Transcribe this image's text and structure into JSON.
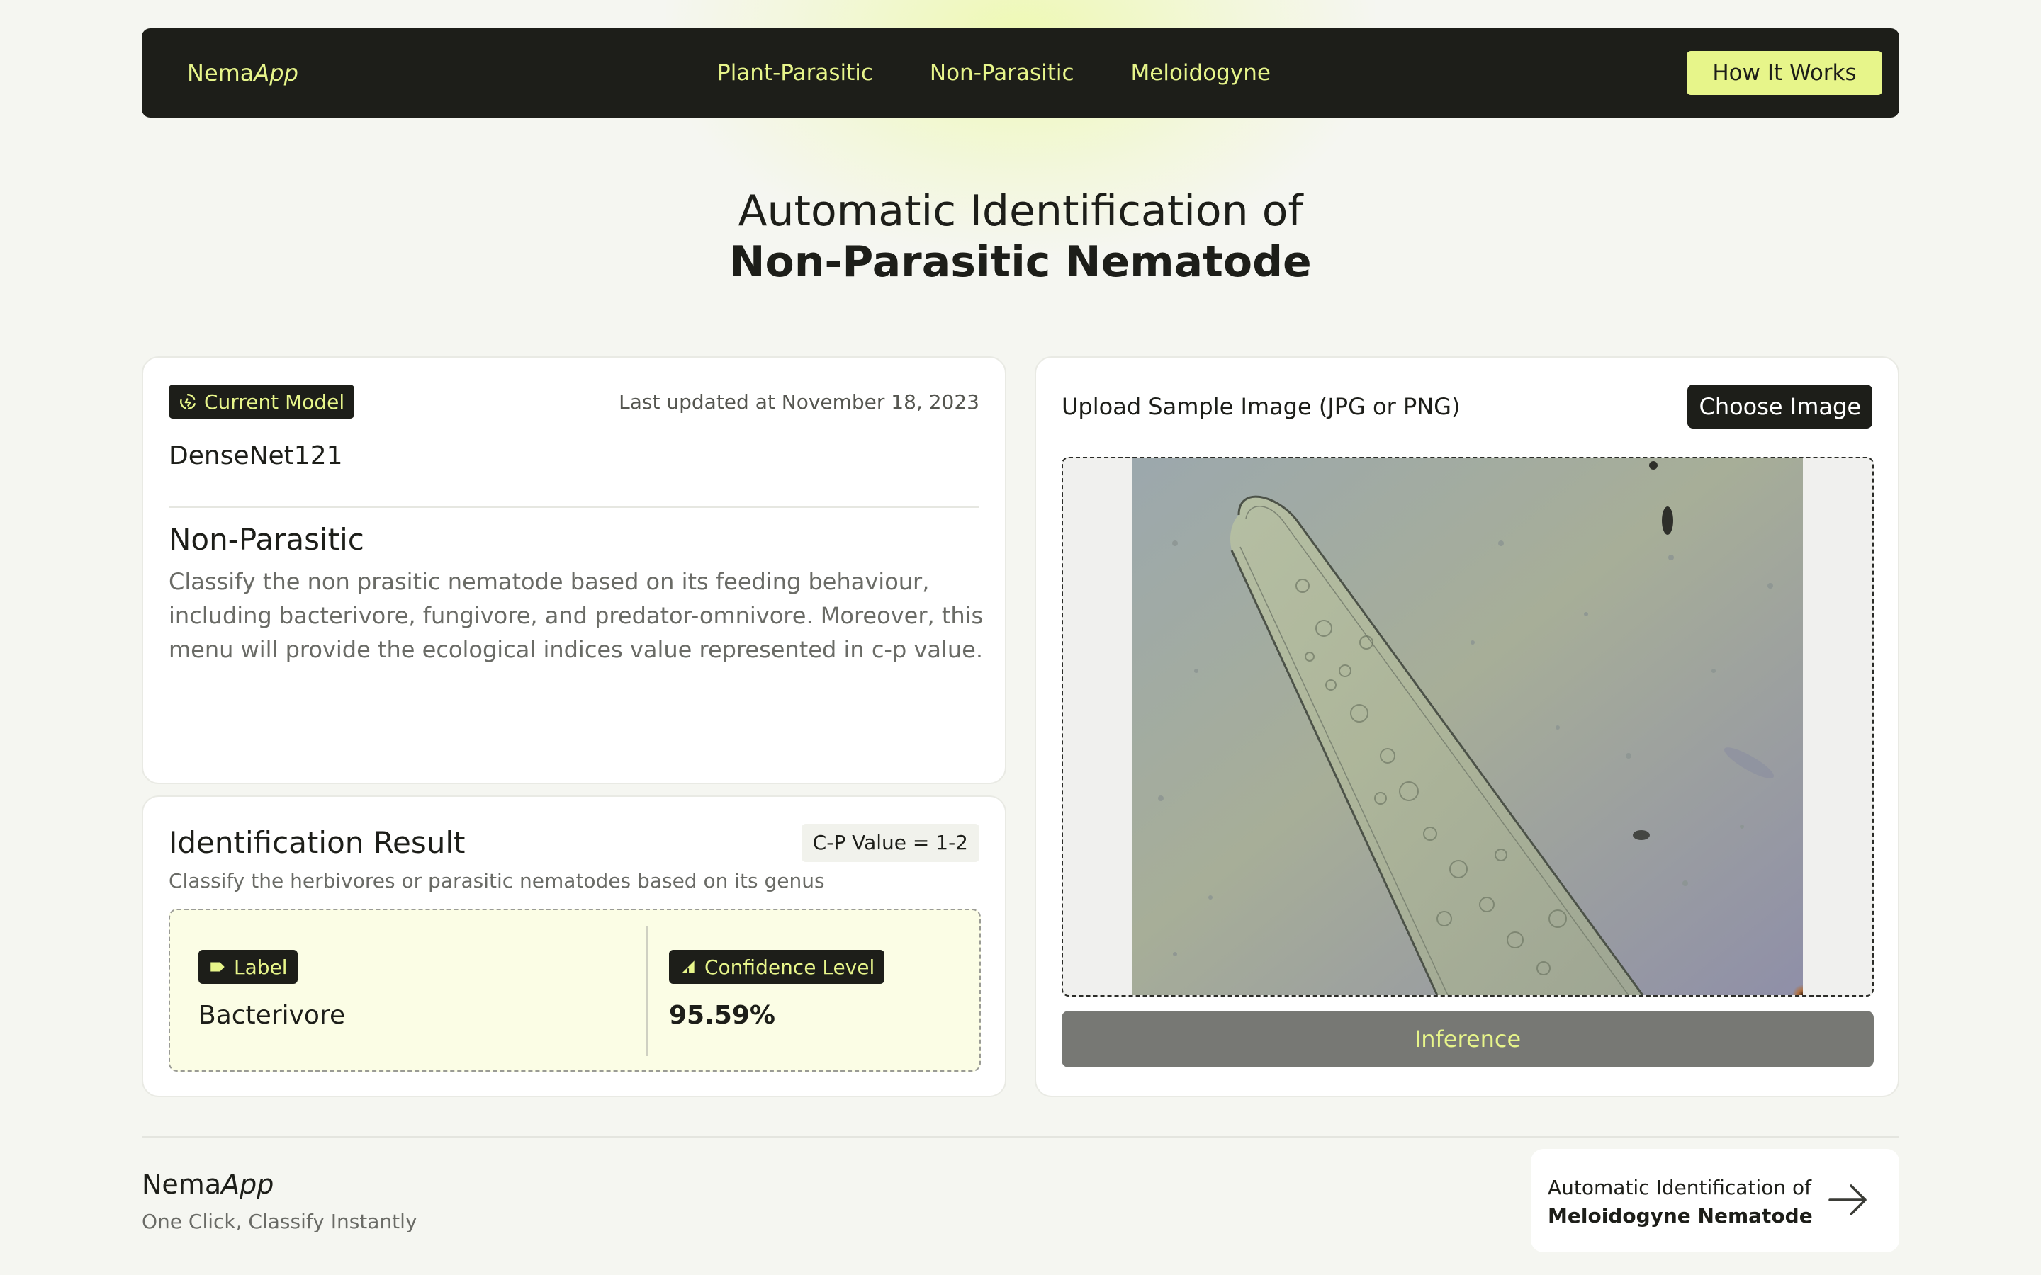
{
  "nav": {
    "brand_main": "Nema",
    "brand_accent": "App",
    "links": [
      "Plant-Parasitic",
      "Non-Parasitic",
      "Meloidogyne"
    ],
    "cta": "How It Works"
  },
  "hero": {
    "line1": "Automatic Identification of",
    "line2": "Non-Parasitic Nematode"
  },
  "model": {
    "badge": "Current Model",
    "badge_icon": "recycle-icon",
    "updated": "Last updated at November 18, 2023",
    "name": "DenseNet121",
    "mode_title": "Non-Parasitic",
    "mode_desc": "Classify the non prasitic nematode based on its feeding behaviour, including bacterivore, fungivore, and predator-omnivore. Moreover, this menu will provide the ecological indices value represented in c-p value."
  },
  "result": {
    "title": "Identification Result",
    "cp_value": "C-P Value = 1-2",
    "subtitle": "Classify the herbivores or parasitic nematodes based on its genus",
    "label_badge": "Label",
    "label_icon": "tag-icon",
    "label_value": "Bacterivore",
    "confidence_badge": "Confidence Level",
    "confidence_icon": "signal-icon",
    "confidence_value": "95.59%"
  },
  "upload": {
    "title": "Upload Sample Image (JPG or PNG)",
    "choose_button": "Choose Image",
    "inference_button": "Inference"
  },
  "footer": {
    "brand_main": "Nema",
    "brand_accent": "App",
    "tagline": "One Click, Classify Instantly",
    "next_line1": "Automatic Identification of",
    "next_line2": "Meloidogyne Nematode",
    "next_icon": "arrow-right-icon"
  },
  "colors": {
    "dark": "#1d1e19",
    "accent": "#e7f58a",
    "background": "#f5f6f1",
    "result_box": "#fbfde5",
    "button_disabled": "#777874"
  }
}
